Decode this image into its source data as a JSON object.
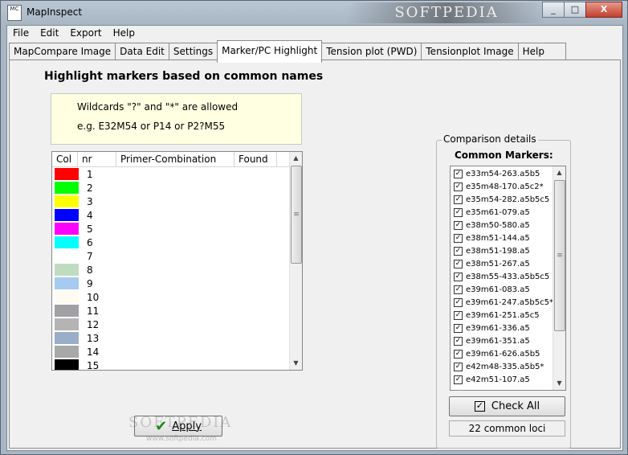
{
  "window": {
    "title": "MapInspect",
    "icon_text": "MC",
    "watermark": "SOFTPEDIA",
    "controls": [
      "_",
      "□",
      "X"
    ]
  },
  "menu": [
    "File",
    "Edit",
    "Export",
    "Help"
  ],
  "tabs": [
    {
      "label": "MapCompare Image",
      "active": false
    },
    {
      "label": "Data Edit",
      "active": false
    },
    {
      "label": "Settings",
      "active": false
    },
    {
      "label": "Marker/PC Highlight",
      "active": true
    },
    {
      "label": "Tension plot (PWD)",
      "active": false
    },
    {
      "label": "Tensionplot Image",
      "active": false
    },
    {
      "label": "Help",
      "active": false
    }
  ],
  "main": {
    "heading": "Highlight markers based on common names",
    "hint_line1": "Wildcards \"?\" and \"*\" are allowed",
    "hint_line2": "e.g. E32M54 or P14 or P2?M55",
    "table": {
      "columns": [
        "Col",
        "nr",
        "Primer-Combination",
        "Found"
      ],
      "rows": [
        {
          "color": "#ff0000",
          "nr": "1"
        },
        {
          "color": "#00ff00",
          "nr": "2"
        },
        {
          "color": "#ffff00",
          "nr": "3"
        },
        {
          "color": "#0000ff",
          "nr": "4"
        },
        {
          "color": "#ff00ff",
          "nr": "5"
        },
        {
          "color": "#00ffff",
          "nr": "6"
        },
        {
          "color": "#ffffff",
          "nr": "7"
        },
        {
          "color": "#c0dcc0",
          "nr": "8"
        },
        {
          "color": "#a6caf0",
          "nr": "9"
        },
        {
          "color": "#fffbf0",
          "nr": "10"
        },
        {
          "color": "#a0a0a4",
          "nr": "11"
        },
        {
          "color": "#b4b4b4",
          "nr": "12"
        },
        {
          "color": "#99aec8",
          "nr": "13"
        },
        {
          "color": "#a8a8a8",
          "nr": "14"
        },
        {
          "color": "#000000",
          "nr": "15"
        }
      ]
    },
    "apply_label": "Apply",
    "apply_watermark": "SOFTPEDIA",
    "apply_watermark_url": "www.softpedia.com"
  },
  "comparison": {
    "group_title": "Comparison details",
    "markers_title": "Common Markers:",
    "markers": [
      "e33m54-263.a5b5",
      "e35m48-170.a5c2*",
      "e35m54-282.a5b5c5",
      "e35m61-079.a5",
      "e38m50-580.a5",
      "e38m51-144.a5",
      "e38m51-198.a5",
      "e38m51-267.a5",
      "e38m55-433.a5b5c5",
      "e39m61-083.a5",
      "e39m61-247.a5b5c5*",
      "e39m61-251.a5c5",
      "e39m61-336.a5",
      "e39m61-351.a5",
      "e39m61-626.a5b5",
      "e42m48-335.a5b5*",
      "e42m51-107.a5"
    ],
    "check_all_label": "Check All",
    "loci_status": "22 common loci"
  }
}
